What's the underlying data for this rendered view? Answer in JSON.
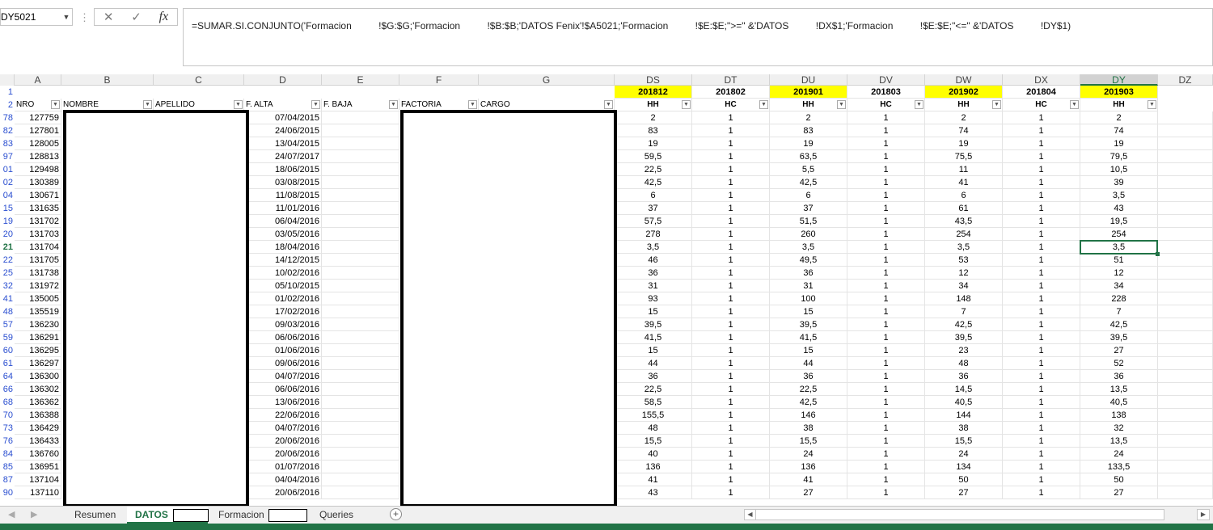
{
  "formula_bar": {
    "name_box": "DY5021",
    "formula": "=SUMAR.SI.CONJUNTO('Formacion          !$G:$G;'Formacion          !$B:$B;'DATOS Fenix'!$A5021;'Formacion          !$E:$E;\">=\" &'DATOS          !DX$1;'Formacion          !$E:$E;\"<=\" &'DATOS          !DY$1)",
    "cancel_icon": "close-icon",
    "enter_icon": "check-icon",
    "fx_label": "fx"
  },
  "columns": [
    {
      "letter": "A"
    },
    {
      "letter": "B"
    },
    {
      "letter": "C"
    },
    {
      "letter": "D"
    },
    {
      "letter": "E"
    },
    {
      "letter": "F"
    },
    {
      "letter": "G"
    },
    {
      "letter": "DS"
    },
    {
      "letter": "DT"
    },
    {
      "letter": "DU"
    },
    {
      "letter": "DV"
    },
    {
      "letter": "DW"
    },
    {
      "letter": "DX"
    },
    {
      "letter": "DY"
    },
    {
      "letter": "DZ"
    }
  ],
  "period_row": [
    "201812",
    "201802",
    "201901",
    "201803",
    "201902",
    "201804",
    "201903"
  ],
  "header_row": {
    "nro": "NRO",
    "nombre": "NOMBRE",
    "apellido": "APELLIDO",
    "f_alta": "F. ALTA",
    "f_baja": "F. BAJA",
    "factoria": "FACTORIA",
    "cargo": "CARGO",
    "metrics": [
      "HH",
      "HC",
      "HH",
      "HC",
      "HH",
      "HC",
      "HH"
    ]
  },
  "row_numbers_top": [
    "1",
    "2"
  ],
  "rows": [
    {
      "rn": "78",
      "nro": "127759",
      "alta": "07/04/2015",
      "v": [
        "2",
        "1",
        "2",
        "1",
        "2",
        "1",
        "2"
      ]
    },
    {
      "rn": "82",
      "nro": "127801",
      "alta": "24/06/2015",
      "v": [
        "83",
        "1",
        "83",
        "1",
        "74",
        "1",
        "74"
      ]
    },
    {
      "rn": "83",
      "nro": "128005",
      "alta": "13/04/2015",
      "v": [
        "19",
        "1",
        "19",
        "1",
        "19",
        "1",
        "19"
      ]
    },
    {
      "rn": "97",
      "nro": "128813",
      "alta": "24/07/2017",
      "v": [
        "59,5",
        "1",
        "63,5",
        "1",
        "75,5",
        "1",
        "79,5"
      ]
    },
    {
      "rn": "01",
      "nro": "129498",
      "alta": "18/06/2015",
      "v": [
        "22,5",
        "1",
        "5,5",
        "1",
        "11",
        "1",
        "10,5"
      ]
    },
    {
      "rn": "02",
      "nro": "130389",
      "alta": "03/08/2015",
      "v": [
        "42,5",
        "1",
        "42,5",
        "1",
        "41",
        "1",
        "39"
      ]
    },
    {
      "rn": "04",
      "nro": "130671",
      "alta": "11/08/2015",
      "v": [
        "6",
        "1",
        "6",
        "1",
        "6",
        "1",
        "3,5"
      ]
    },
    {
      "rn": "15",
      "nro": "131635",
      "alta": "11/01/2016",
      "v": [
        "37",
        "1",
        "37",
        "1",
        "61",
        "1",
        "43"
      ]
    },
    {
      "rn": "19",
      "nro": "131702",
      "alta": "06/04/2016",
      "v": [
        "57,5",
        "1",
        "51,5",
        "1",
        "43,5",
        "1",
        "19,5"
      ]
    },
    {
      "rn": "20",
      "nro": "131703",
      "alta": "03/05/2016",
      "v": [
        "278",
        "1",
        "260",
        "1",
        "254",
        "1",
        "254"
      ]
    },
    {
      "rn": "21",
      "nro": "131704",
      "alta": "18/04/2016",
      "v": [
        "3,5",
        "1",
        "3,5",
        "1",
        "3,5",
        "1",
        "3,5"
      ]
    },
    {
      "rn": "22",
      "nro": "131705",
      "alta": "14/12/2015",
      "v": [
        "46",
        "1",
        "49,5",
        "1",
        "53",
        "1",
        "51"
      ]
    },
    {
      "rn": "25",
      "nro": "131738",
      "alta": "10/02/2016",
      "v": [
        "36",
        "1",
        "36",
        "1",
        "12",
        "1",
        "12"
      ]
    },
    {
      "rn": "32",
      "nro": "131972",
      "alta": "05/10/2015",
      "v": [
        "31",
        "1",
        "31",
        "1",
        "34",
        "1",
        "34"
      ]
    },
    {
      "rn": "41",
      "nro": "135005",
      "alta": "01/02/2016",
      "v": [
        "93",
        "1",
        "100",
        "1",
        "148",
        "1",
        "228"
      ]
    },
    {
      "rn": "48",
      "nro": "135519",
      "alta": "17/02/2016",
      "v": [
        "15",
        "1",
        "15",
        "1",
        "7",
        "1",
        "7"
      ]
    },
    {
      "rn": "57",
      "nro": "136230",
      "alta": "09/03/2016",
      "v": [
        "39,5",
        "1",
        "39,5",
        "1",
        "42,5",
        "1",
        "42,5"
      ]
    },
    {
      "rn": "59",
      "nro": "136291",
      "alta": "06/06/2016",
      "v": [
        "41,5",
        "1",
        "41,5",
        "1",
        "39,5",
        "1",
        "39,5"
      ]
    },
    {
      "rn": "60",
      "nro": "136295",
      "alta": "01/06/2016",
      "v": [
        "15",
        "1",
        "15",
        "1",
        "23",
        "1",
        "27"
      ]
    },
    {
      "rn": "61",
      "nro": "136297",
      "alta": "09/06/2016",
      "v": [
        "44",
        "1",
        "44",
        "1",
        "48",
        "1",
        "52"
      ]
    },
    {
      "rn": "64",
      "nro": "136300",
      "alta": "04/07/2016",
      "v": [
        "36",
        "1",
        "36",
        "1",
        "36",
        "1",
        "36"
      ]
    },
    {
      "rn": "66",
      "nro": "136302",
      "alta": "06/06/2016",
      "v": [
        "22,5",
        "1",
        "22,5",
        "1",
        "14,5",
        "1",
        "13,5"
      ]
    },
    {
      "rn": "68",
      "nro": "136362",
      "alta": "13/06/2016",
      "v": [
        "58,5",
        "1",
        "42,5",
        "1",
        "40,5",
        "1",
        "40,5"
      ]
    },
    {
      "rn": "70",
      "nro": "136388",
      "alta": "22/06/2016",
      "v": [
        "155,5",
        "1",
        "146",
        "1",
        "144",
        "1",
        "138"
      ]
    },
    {
      "rn": "73",
      "nro": "136429",
      "alta": "04/07/2016",
      "v": [
        "48",
        "1",
        "38",
        "1",
        "38",
        "1",
        "32"
      ]
    },
    {
      "rn": "76",
      "nro": "136433",
      "alta": "20/06/2016",
      "v": [
        "15,5",
        "1",
        "15,5",
        "1",
        "15,5",
        "1",
        "13,5"
      ]
    },
    {
      "rn": "84",
      "nro": "136760",
      "alta": "20/06/2016",
      "v": [
        "40",
        "1",
        "24",
        "1",
        "24",
        "1",
        "24"
      ]
    },
    {
      "rn": "85",
      "nro": "136951",
      "alta": "01/07/2016",
      "v": [
        "136",
        "1",
        "136",
        "1",
        "134",
        "1",
        "133,5"
      ]
    },
    {
      "rn": "87",
      "nro": "137104",
      "alta": "04/04/2016",
      "v": [
        "41",
        "1",
        "41",
        "1",
        "50",
        "1",
        "50"
      ]
    },
    {
      "rn": "90",
      "nro": "137110",
      "alta": "20/06/2016",
      "v": [
        "43",
        "1",
        "27",
        "1",
        "27",
        "1",
        "27"
      ]
    }
  ],
  "sheet_tabs": [
    {
      "label": "Resumen",
      "active": false
    },
    {
      "label": "DATOS",
      "active": true
    },
    {
      "label": "Formacion",
      "active": false
    },
    {
      "label": "Queries",
      "active": false
    }
  ],
  "add_sheet_label": "+",
  "colors": {
    "accent": "#217346",
    "highlight": "#ffff00",
    "row_number_blue": "#2a4ed0"
  }
}
